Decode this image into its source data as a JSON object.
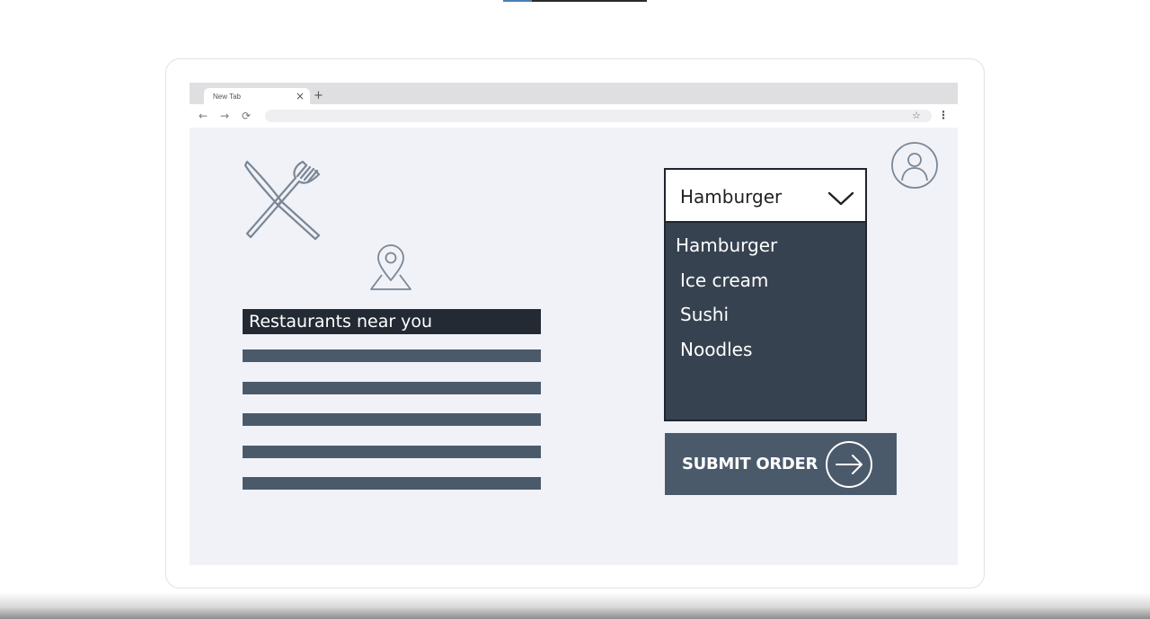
{
  "progress": {
    "fraction": 0.2
  },
  "browser": {
    "tab_title": "New Tab",
    "tab_close": "×",
    "new_tab": "+",
    "nav": {
      "back": "←",
      "forward": "→",
      "reload": "⟳"
    },
    "bookmark": "☆",
    "menu": "⋮"
  },
  "page": {
    "restaurants_heading": "Restaurants near you",
    "restaurant_placeholder_count": 5,
    "dropdown": {
      "selected": "Hamburger",
      "options": [
        "Hamburger",
        "Ice cream",
        "Sushi",
        "Noodles"
      ]
    },
    "submit_label": "SUBMIT ORDER"
  },
  "colors": {
    "page_bg": "#f0f2f7",
    "header_bar": "#232a33",
    "placeholder_line": "#4b5a6b",
    "dropdown_list": "#36424f",
    "submit_button": "#4b5a6b",
    "icon_stroke": "#7a8796"
  },
  "icons": {
    "cutlery": "cutlery-icon",
    "pin": "location-pin-icon",
    "avatar": "user-avatar-icon",
    "chevron": "chevron-down-icon",
    "arrow": "arrow-right-circle-icon"
  }
}
